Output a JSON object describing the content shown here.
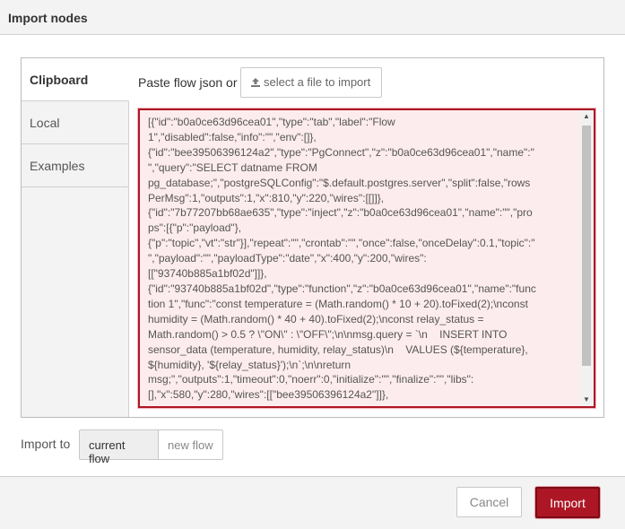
{
  "dialog": {
    "title": "Import nodes"
  },
  "tabs": [
    {
      "label": "Clipboard",
      "active": true
    },
    {
      "label": "Local",
      "active": false
    },
    {
      "label": "Examples",
      "active": false
    }
  ],
  "clipboard": {
    "paste_label": "Paste flow json or",
    "select_file_label": "select a file to import",
    "select_file_icon": "upload-icon",
    "json_lines": [
      "[{\"id\":\"b0a0ce63d96cea01\",\"type\":\"tab\",\"label\":\"Flow",
      "1\",\"disabled\":false,\"info\":\"\",\"env\":[]},",
      "{\"id\":\"bee39506396124a2\",\"type\":\"PgConnect\",\"z\":\"b0a0ce63d96cea01\",\"name\":\"",
      "\",\"query\":\"SELECT datname FROM",
      "pg_database;\",\"postgreSQLConfig\":\"$.default.postgres.server\",\"split\":false,\"rows",
      "PerMsg\":1,\"outputs\":1,\"x\":810,\"y\":220,\"wires\":[[]]},",
      "{\"id\":\"7b77207bb68ae635\",\"type\":\"inject\",\"z\":\"b0a0ce63d96cea01\",\"name\":\"\",\"pro",
      "ps\":[{\"p\":\"payload\"},",
      "{\"p\":\"topic\",\"vt\":\"str\"}],\"repeat\":\"\",\"crontab\":\"\",\"once\":false,\"onceDelay\":0.1,\"topic\":\"",
      "\",\"payload\":\"\",\"payloadType\":\"date\",\"x\":400,\"y\":200,\"wires\":",
      "[[\"93740b885a1bf02d\"]]},",
      "{\"id\":\"93740b885a1bf02d\",\"type\":\"function\",\"z\":\"b0a0ce63d96cea01\",\"name\":\"func",
      "tion 1\",\"func\":\"const temperature = (Math.random() * 10 + 20).toFixed(2);\\nconst",
      "humidity = (Math.random() * 40 + 40).toFixed(2);\\nconst relay_status =",
      "Math.random() > 0.5 ? \\\"ON\\\" : \\\"OFF\\\";\\n\\nmsg.query = `\\n    INSERT INTO",
      "sensor_data (temperature, humidity, relay_status)\\n    VALUES (${temperature},",
      "${humidity}, '${relay_status}');\\n`;\\n\\nreturn",
      "msg;\",\"outputs\":1,\"timeout\":0,\"noerr\":0,\"initialize\":\"\",\"finalize\":\"\",\"libs\":",
      "[],\"x\":580,\"y\":280,\"wires\":[[\"bee39506396124a2\"]]},"
    ]
  },
  "import_to": {
    "label": "Import to",
    "options": [
      {
        "label": "current flow",
        "selected": true
      },
      {
        "label": "new flow",
        "selected": false
      }
    ]
  },
  "footer": {
    "cancel_label": "Cancel",
    "import_label": "Import"
  },
  "colors": {
    "accent": "#ad1625",
    "json_box_bg": "#fdeced"
  }
}
